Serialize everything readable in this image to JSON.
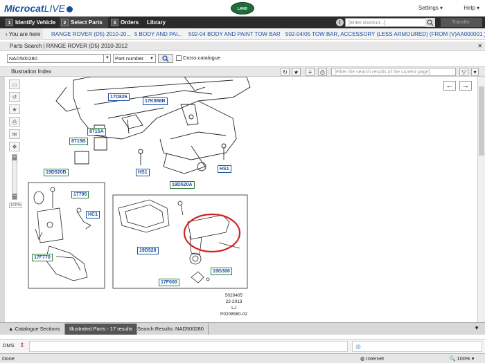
{
  "app": {
    "brand": "Microcat",
    "brand_suffix": "LIVE",
    "logo_text": "LAND ROVER"
  },
  "topmenu": {
    "settings": "Settings",
    "help": "Help"
  },
  "nav": {
    "tabs": [
      {
        "num": "1",
        "label": "Identify Vehicle"
      },
      {
        "num": "2",
        "label": "Select Parts"
      },
      {
        "num": "3",
        "label": "Orders"
      },
      {
        "num": "",
        "label": "Library"
      }
    ],
    "shortcut_placeholder": "[Enter shortcut...]",
    "transfer": "Transfer"
  },
  "breadcrumb": {
    "here": "You are here",
    "items": [
      "RANGE ROVER (D5) 2010-20...",
      "5 BODY AND PAI...",
      "502-04 BODY AND PAINT TOW BAR",
      "502-04/05 TOW BAR, ACCESSORY (LESS ARMOURED) (FROM (V)AA000001 )"
    ]
  },
  "parts_search": {
    "title": "Parts Search | RANGE ROVER (D5) 2010-2012",
    "input_value": "NAD500280",
    "type_value": "Part number",
    "cross_catalogue": "Cross catalogue"
  },
  "illustration": {
    "title": "Illustration Index",
    "filter_placeholder": "[Filter the search results of the current page]",
    "callouts": [
      "17D826",
      "17K866B",
      "8715A",
      "8715B",
      "HS1",
      "HS1",
      "19D520B",
      "19D520A",
      "17795",
      "HC1",
      "17F770",
      "19D528",
      "17F000",
      "19G306"
    ],
    "figure_id": [
      "5020405",
      "22-2013",
      "LJ",
      "P0208580-02"
    ]
  },
  "bottom_tabs": [
    "Catalogue Sections",
    "Illustrated Parts - 17 results",
    "Search Results: NAD500280"
  ],
  "dms": {
    "label": "DMS"
  },
  "status": {
    "done": "Done",
    "zone": "Internet",
    "zoom": "100%"
  }
}
